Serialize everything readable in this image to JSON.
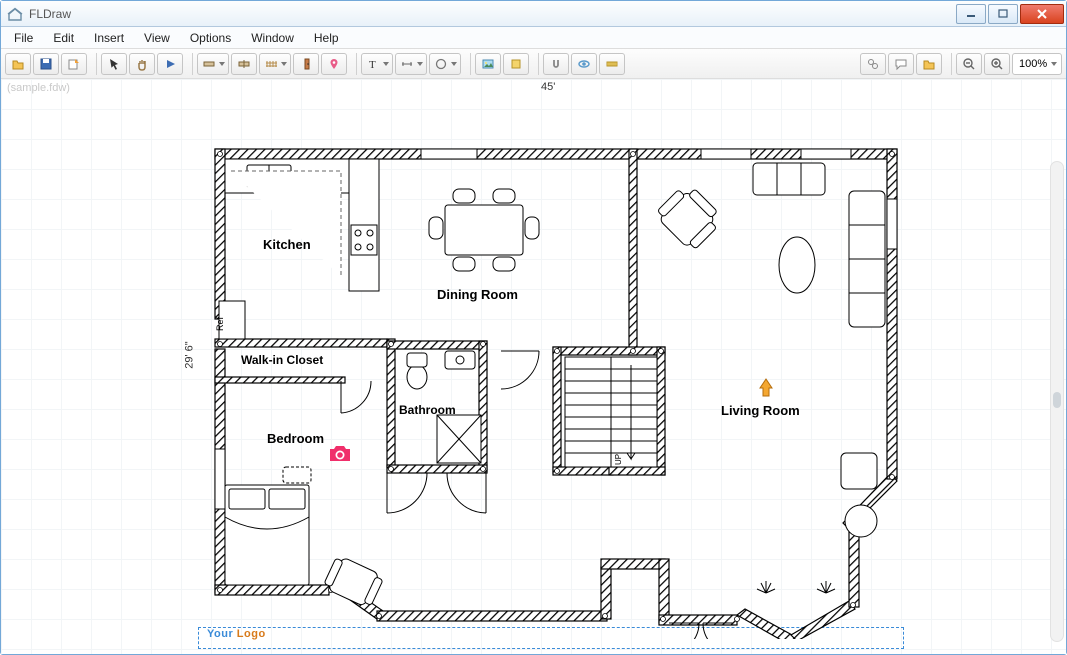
{
  "window": {
    "title": "FLDraw"
  },
  "filename_watermark": "(sample.fdw)",
  "menu": [
    "File",
    "Edit",
    "Insert",
    "View",
    "Options",
    "Window",
    "Help"
  ],
  "toolbar": {
    "open": "open",
    "save": "save",
    "export": "export",
    "pointer": "pointer",
    "pan": "pan",
    "play": "play",
    "wall": "wall",
    "wall2": "wall2",
    "grid-wall": "grid-wall",
    "door": "door",
    "pin": "pin",
    "text": "text",
    "dimension": "dimension",
    "shape": "shape",
    "image": "image",
    "color": "color",
    "snap": "snap",
    "view3d": "view3d",
    "measure": "measure"
  },
  "right_toolbar": {
    "settings": "settings",
    "comment": "comment",
    "folder": "folder",
    "zoom_out": "zoom_out",
    "zoom_in": "zoom_in",
    "zoom_value": "100%"
  },
  "dimensions": {
    "width": "45'",
    "height": "29' 6\""
  },
  "rooms": {
    "kitchen": "Kitchen",
    "dining": "Dining Room",
    "living": "Living Room",
    "closet": "Walk-in Closet",
    "bathroom": "Bathroom",
    "bedroom": "Bedroom",
    "ref": "Ref",
    "stairs_up": "UP"
  },
  "logo": {
    "your": "Your ",
    "logo": "Logo"
  }
}
